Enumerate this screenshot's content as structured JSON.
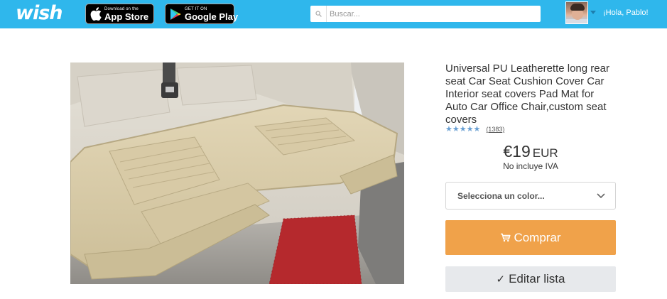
{
  "header": {
    "logo_text": "wish",
    "app_store": {
      "small": "Download on the",
      "big": "App Store"
    },
    "google_play": {
      "small": "GET IT ON",
      "big": "Google Play"
    },
    "search": {
      "placeholder": "Buscar...",
      "value": ""
    },
    "greeting": "¡Hola, Pablo!",
    "bar_color": "#2fb7ec"
  },
  "product": {
    "title": "Universal PU Leatherette long rear seat Car Seat Cushion Cover Car Interior seat covers Pad Mat for Auto Car Office Chair,custom seat covers",
    "rating": {
      "stars_text": "★★★★★",
      "stars": 4.5,
      "reviews": "(1383)"
    },
    "price": {
      "amount": "€19",
      "currency": "EUR"
    },
    "tax_note": "No incluye IVA",
    "color_select_label": "Selecciona un color...",
    "buy_label": "Comprar",
    "edit_label": "Editar lista",
    "accent_color": "#f0a24a"
  },
  "icons": {
    "app_store": "apple-icon",
    "google_play": "play-icon",
    "search": "search-icon",
    "buy": "cart-icon",
    "edit": "check-icon",
    "select": "chevron-down-icon"
  }
}
